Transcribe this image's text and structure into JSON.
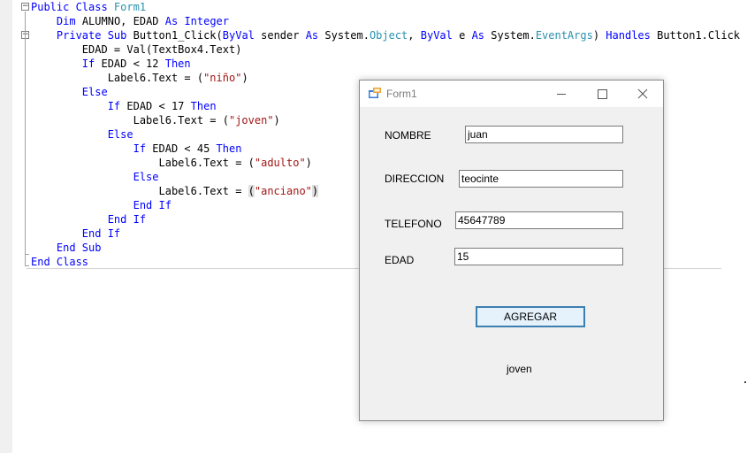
{
  "code_lines": [
    [
      {
        "t": "Public Class ",
        "c": "kw"
      },
      {
        "t": "Form1",
        "c": "ty"
      }
    ],
    [
      {
        "t": "    "
      },
      {
        "t": "Dim",
        "c": "kw"
      },
      {
        "t": " ALUMNO, EDAD "
      },
      {
        "t": "As",
        "c": "kw"
      },
      {
        "t": " "
      },
      {
        "t": "Integer",
        "c": "kw"
      }
    ],
    [
      {
        "t": "    "
      },
      {
        "t": "Private Sub",
        "c": "kw"
      },
      {
        "t": " Button1_Click("
      },
      {
        "t": "ByVal",
        "c": "kw"
      },
      {
        "t": " sender "
      },
      {
        "t": "As",
        "c": "kw"
      },
      {
        "t": " System."
      },
      {
        "t": "Object",
        "c": "ty"
      },
      {
        "t": ", "
      },
      {
        "t": "ByVal",
        "c": "kw"
      },
      {
        "t": " e "
      },
      {
        "t": "As",
        "c": "kw"
      },
      {
        "t": " System."
      },
      {
        "t": "EventArgs",
        "c": "ty"
      },
      {
        "t": ") "
      },
      {
        "t": "Handles",
        "c": "kw"
      },
      {
        "t": " Button1.Click"
      }
    ],
    [
      {
        "t": "        EDAD = Val(TextBox4.Text)"
      }
    ],
    [
      {
        "t": "        "
      },
      {
        "t": "If",
        "c": "kw"
      },
      {
        "t": " EDAD < 12 "
      },
      {
        "t": "Then",
        "c": "kw"
      }
    ],
    [
      {
        "t": "            Label6.Text = ("
      },
      {
        "t": "\"niño\"",
        "c": "str"
      },
      {
        "t": ")"
      }
    ],
    [
      {
        "t": "        "
      },
      {
        "t": "Else",
        "c": "kw"
      }
    ],
    [
      {
        "t": "            "
      },
      {
        "t": "If",
        "c": "kw"
      },
      {
        "t": " EDAD < 17 "
      },
      {
        "t": "Then",
        "c": "kw"
      }
    ],
    [
      {
        "t": "                Label6.Text = ("
      },
      {
        "t": "\"joven\"",
        "c": "str"
      },
      {
        "t": ")"
      }
    ],
    [
      {
        "t": "            "
      },
      {
        "t": "Else",
        "c": "kw"
      }
    ],
    [
      {
        "t": "                "
      },
      {
        "t": "If",
        "c": "kw"
      },
      {
        "t": " EDAD < 45 "
      },
      {
        "t": "Then",
        "c": "kw"
      }
    ],
    [
      {
        "t": "                    Label6.Text = ("
      },
      {
        "t": "\"adulto\"",
        "c": "str"
      },
      {
        "t": ")"
      }
    ],
    [
      {
        "t": "                "
      },
      {
        "t": "Else",
        "c": "kw"
      }
    ],
    [
      {
        "t": "                    Label6.Text = "
      },
      {
        "t": "(",
        "c": "hl"
      },
      {
        "t": "\"anciano\"",
        "c": "str"
      },
      {
        "t": ")",
        "c": "hl"
      }
    ],
    [
      {
        "t": "                "
      },
      {
        "t": "End If",
        "c": "kw"
      }
    ],
    [
      {
        "t": "            "
      },
      {
        "t": "End If",
        "c": "kw"
      }
    ],
    [
      {
        "t": "        "
      },
      {
        "t": "End If",
        "c": "kw"
      }
    ],
    [
      {
        "t": "    "
      },
      {
        "t": "End Sub",
        "c": "kw"
      }
    ],
    [
      {
        "t": "End Class",
        "c": "kw"
      }
    ]
  ],
  "form": {
    "title": "Form1",
    "fields": [
      {
        "label": "NOMBRE",
        "value": "juan"
      },
      {
        "label": "DIRECCION",
        "value": "teocinte"
      },
      {
        "label": "TELEFONO",
        "value": "45647789"
      },
      {
        "label": "EDAD",
        "value": "15"
      }
    ],
    "button_label": "AGREGAR",
    "result_label": "joven"
  }
}
